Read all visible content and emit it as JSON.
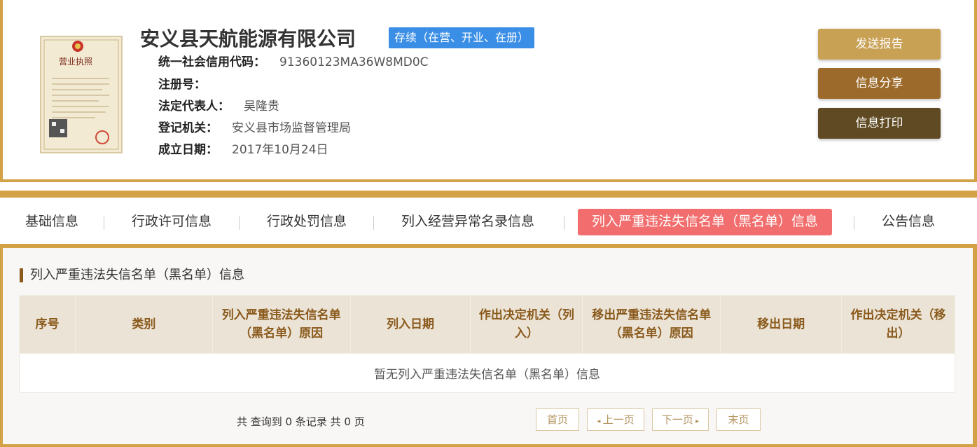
{
  "company": {
    "name": "安义县天航能源有限公司",
    "status": "存续（在营、开业、在册）",
    "license_image_title": "营业执照",
    "fields": [
      {
        "label": "统一社会信用代码：",
        "value": "91360123MA36W8MD0C"
      },
      {
        "label": "注册号：",
        "value": ""
      },
      {
        "label": "法定代表人：",
        "value": "吴隆贵"
      },
      {
        "label": "登记机关：",
        "value": "安义县市场监督管理局"
      },
      {
        "label": "成立日期：",
        "value": "2017年10月24日"
      }
    ]
  },
  "actions": {
    "send_report": "发送报告",
    "share": "信息分享",
    "print": "信息打印"
  },
  "tabs": [
    {
      "label": "基础信息",
      "active": false
    },
    {
      "label": "行政许可信息",
      "active": false
    },
    {
      "label": "行政处罚信息",
      "active": false
    },
    {
      "label": "列入经营异常名录信息",
      "active": false
    },
    {
      "label": "列入严重违法失信名单（黑名单）信息",
      "active": true
    },
    {
      "label": "公告信息",
      "active": false
    }
  ],
  "section": {
    "title": "列入严重违法失信名单（黑名单）信息",
    "columns": [
      "序号",
      "类别",
      "列入严重违法失信名单（黑名单）原因",
      "列入日期",
      "作出决定机关（列入）",
      "移出严重违法失信名单（黑名单）原因",
      "移出日期",
      "作出决定机关（移出）"
    ],
    "empty_message": "暂无列入严重违法失信名单（黑名单）信息"
  },
  "pager": {
    "summary": "共 查询到 0 条记录 共 0 页",
    "first": "首页",
    "prev": "上一页",
    "next": "下一页",
    "last": "末页"
  },
  "colors": {
    "accent_gold": "#d4a246",
    "status_blue": "#3a8ee6",
    "active_tab": "#f26e6e",
    "btn_send": "#c9a155",
    "btn_share": "#9c6a2a",
    "btn_print": "#5f4a23"
  }
}
